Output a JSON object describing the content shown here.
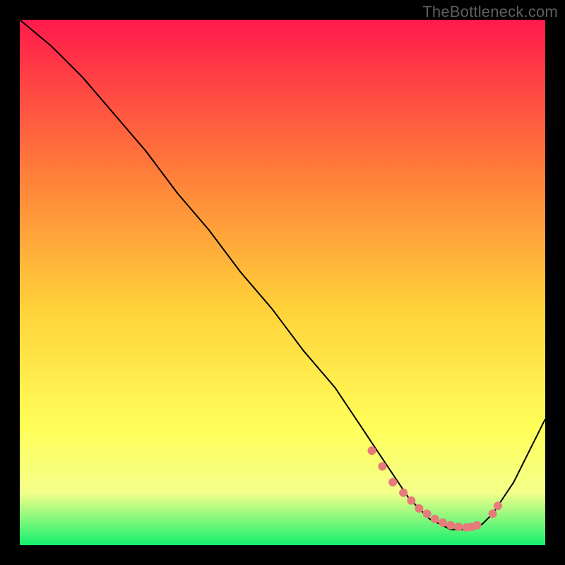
{
  "watermark": "TheBottleneck.com",
  "colors": {
    "frame": "#000000",
    "curve": "#000000",
    "dots": "#e77b7b",
    "gradient_top": "#ff1a4c",
    "gradient_mid1": "#ff7a3a",
    "gradient_mid2": "#ffd23a",
    "gradient_mid3": "#ffff5a",
    "gradient_mid4": "#f4ff8a",
    "gradient_bottom": "#14f06e"
  },
  "chart_data": {
    "type": "line",
    "title": "",
    "xlabel": "",
    "ylabel": "",
    "xlim": [
      0,
      100
    ],
    "ylim": [
      0,
      100
    ],
    "series": [
      {
        "name": "bottleneck-curve",
        "x": [
          0,
          6,
          12,
          18,
          24,
          30,
          36,
          42,
          48,
          54,
          60,
          64,
          68,
          72,
          74,
          76,
          78,
          80,
          82,
          84,
          86,
          88,
          90,
          92,
          94,
          96,
          98,
          100
        ],
        "values": [
          100,
          95,
          89,
          82,
          75,
          67,
          60,
          52,
          45,
          37,
          30,
          24,
          18,
          12,
          9,
          7,
          5,
          4,
          3,
          3,
          3,
          4,
          6,
          9,
          12,
          16,
          20,
          24
        ]
      }
    ],
    "highlight_points": {
      "name": "optimal-region-dots",
      "x": [
        67,
        69,
        71,
        73,
        74.5,
        76,
        77.5,
        79,
        80.5,
        82,
        83.5,
        85,
        86,
        87,
        90,
        91
      ],
      "values": [
        18,
        15,
        12,
        10,
        8.5,
        7,
        6,
        5,
        4.3,
        3.8,
        3.5,
        3.4,
        3.5,
        3.8,
        6,
        7.5
      ]
    }
  }
}
